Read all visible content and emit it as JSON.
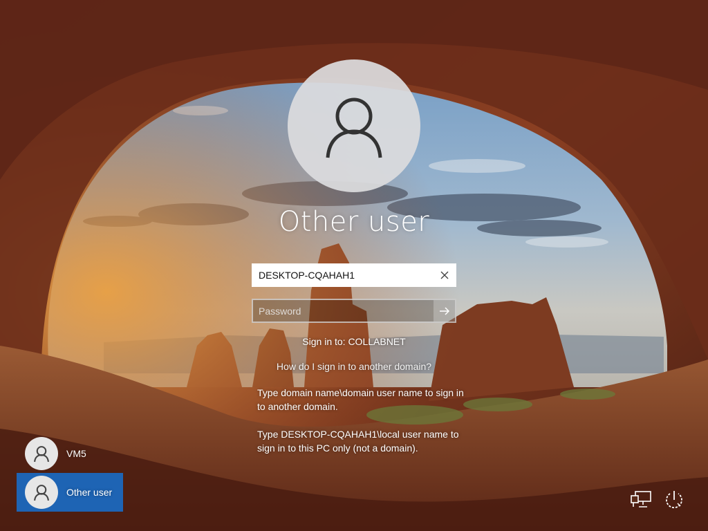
{
  "login": {
    "title": "Other user",
    "username_value": "DESKTOP-CQAHAH1",
    "password_placeholder": "Password",
    "sign_in_to": "Sign in to: COLLABNET",
    "help_link": "How do I sign in to another domain?",
    "help_text_1": "Type domain name\\domain user name to sign in to another domain.",
    "help_text_2": "Type DESKTOP-CQAHAH1\\local user name to sign in to this PC only (not a domain)."
  },
  "users": [
    {
      "name": "VM5",
      "selected": false
    },
    {
      "name": "Other user",
      "selected": true
    }
  ],
  "icons": {
    "clear": "close-icon",
    "submit": "arrow-right-icon",
    "avatar": "user-icon",
    "network": "network-icon",
    "power": "power-icon"
  },
  "colors": {
    "selected_user": "#1e64b4",
    "avatar_bg": "#dcdcde"
  }
}
